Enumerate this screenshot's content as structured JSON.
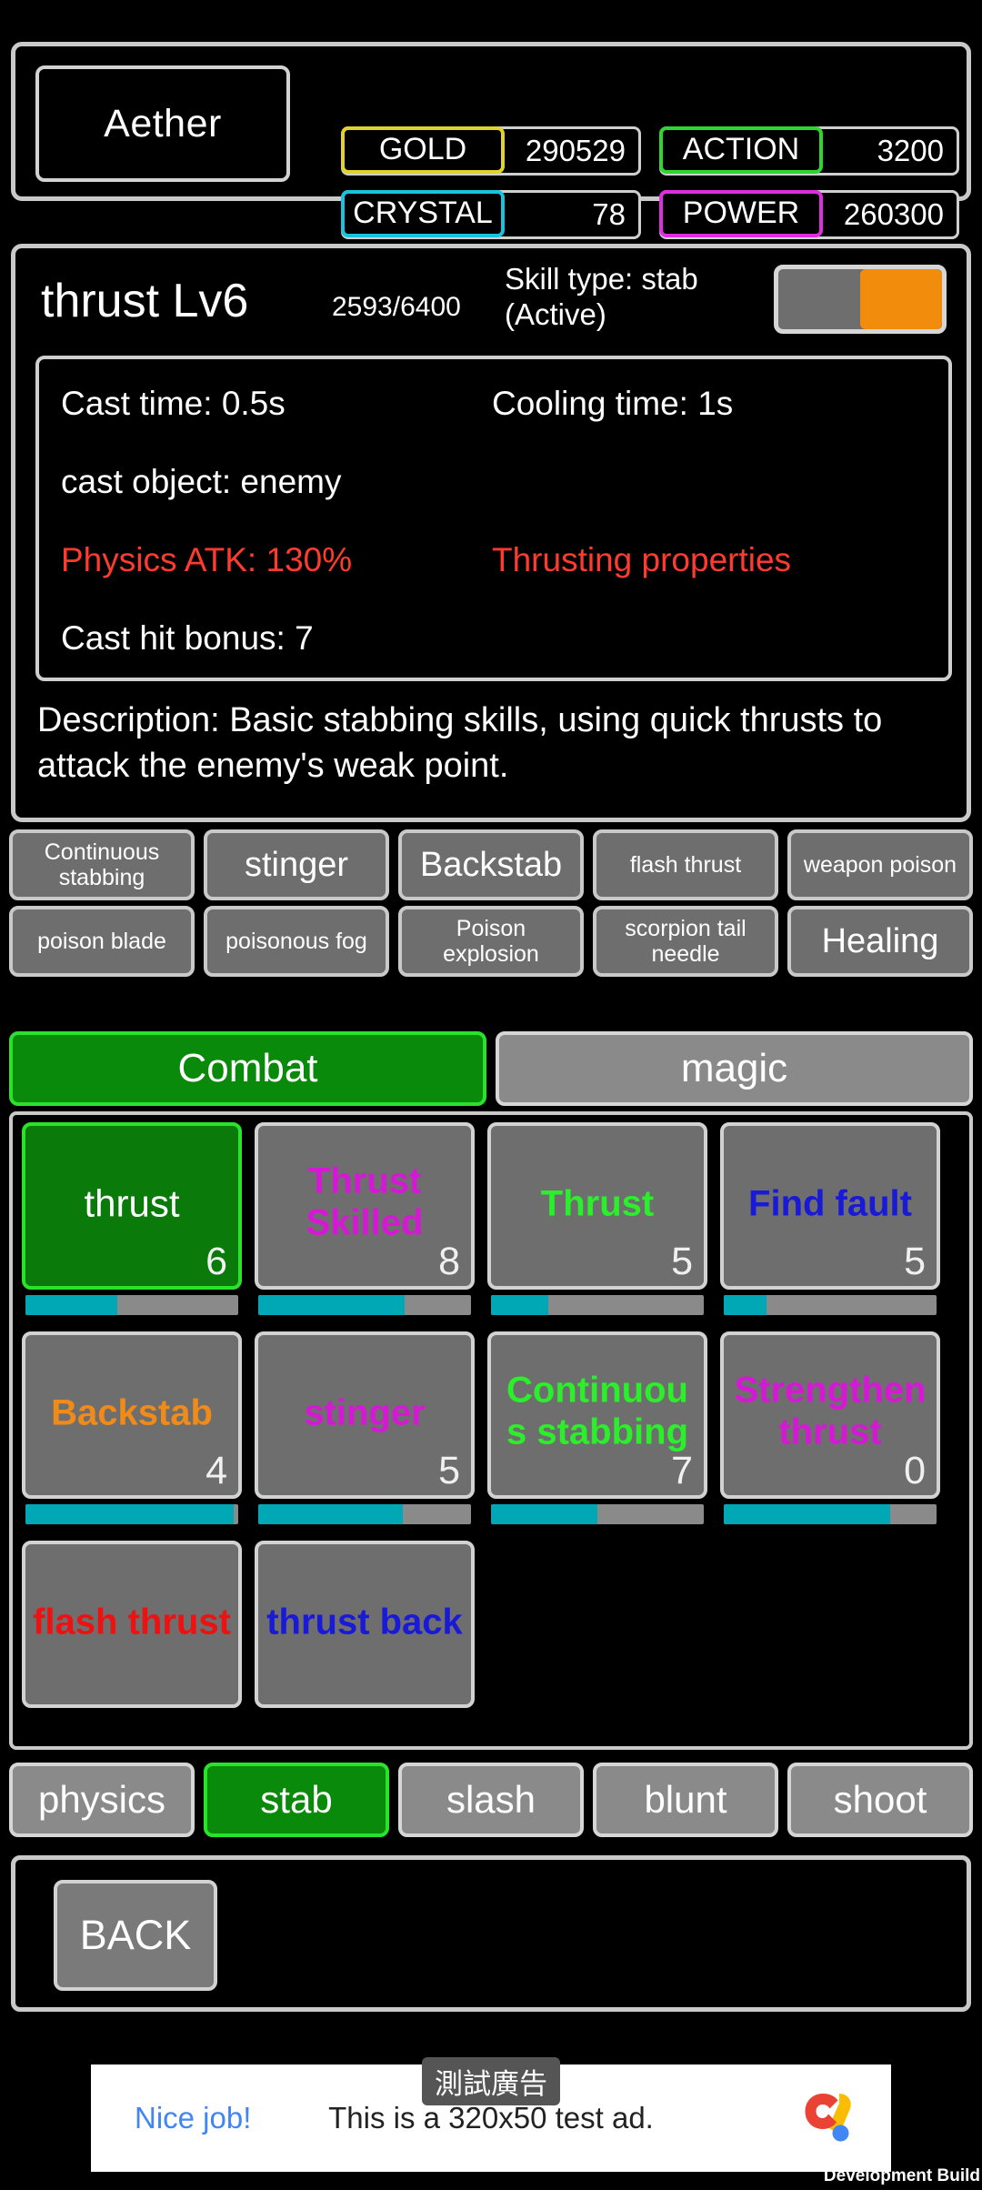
{
  "status": {
    "player_name": "Aether",
    "stats": [
      {
        "key": "gold",
        "label": "GOLD",
        "value": "290529",
        "color": "#e0d42a"
      },
      {
        "key": "action",
        "label": "ACTION",
        "value": "3200",
        "color": "#2fd62f"
      },
      {
        "key": "crystal",
        "label": "CRYSTAL",
        "value": "78",
        "color": "#19c3e0"
      },
      {
        "key": "power",
        "label": "POWER",
        "value": "260300",
        "color": "#dd2fdd"
      }
    ]
  },
  "detail": {
    "skill_name": "thrust Lv6",
    "exp": "2593/6400",
    "skill_type": "Skill type: stab (Active)",
    "toggle_state": "on",
    "cast_time": "Cast time: 0.5s",
    "cooling_time": "Cooling time: 1s",
    "cast_object": "cast object: enemy",
    "physics_atk": "Physics ATK: 130%",
    "properties": "Thrusting properties",
    "cast_hit_bonus": "Cast hit bonus: 7",
    "description": "Description: Basic stabbing skills, using quick thrusts to attack the enemy's weak point.",
    "accent_red": "#ff3b30",
    "toggle_knob_color": "#f28c0c"
  },
  "chips": {
    "row1": [
      "Continuous stabbing",
      "stinger",
      "Backstab",
      "flash thrust",
      "weapon poison"
    ],
    "row2": [
      "poison blade",
      "poisonous fog",
      "Poison explosion",
      "scorpion tail needle",
      "Healing"
    ]
  },
  "tabs": [
    {
      "label": "Combat",
      "selected": true
    },
    {
      "label": "magic",
      "selected": false
    }
  ],
  "grid": {
    "cards": [
      {
        "label": "thrust",
        "level": "6",
        "color": "#ffffff",
        "progress": 43,
        "selected": true
      },
      {
        "label": "Thrust Skilled",
        "level": "8",
        "color": "#d618d6",
        "progress": 69,
        "selected": false
      },
      {
        "label": "Thrust",
        "level": "5",
        "color": "#2aef2a",
        "progress": 27,
        "selected": false
      },
      {
        "label": "Find fault",
        "level": "5",
        "color": "#1919d8",
        "progress": 20,
        "selected": false
      },
      {
        "label": "Backstab",
        "level": "4",
        "color": "#f08a18",
        "progress": 98,
        "selected": false
      },
      {
        "label": "stinger",
        "level": "5",
        "color": "#d618d6",
        "progress": 68,
        "selected": false
      },
      {
        "label": "Continuous stabbing",
        "level": "7",
        "color": "#2aef2a",
        "progress": 50,
        "selected": false
      },
      {
        "label": "Strengthen thrust",
        "level": "0",
        "color": "#d618d6",
        "progress": 78,
        "selected": false
      },
      {
        "label": "flash thrust",
        "level": "",
        "color": "#ee1111",
        "progress": 0,
        "selected": false
      },
      {
        "label": "thrust back",
        "level": "",
        "color": "#1919d8",
        "progress": 0,
        "selected": false
      }
    ]
  },
  "filters": [
    {
      "label": "physics",
      "selected": false
    },
    {
      "label": "stab",
      "selected": true
    },
    {
      "label": "slash",
      "selected": false
    },
    {
      "label": "blunt",
      "selected": false
    },
    {
      "label": "shoot",
      "selected": false
    }
  ],
  "bottom": {
    "back_label": "BACK"
  },
  "ad": {
    "badge": "測試廣告",
    "cta": "Nice job!",
    "text": "This is a 320x50 test ad.",
    "dev_build": "Development Build"
  }
}
